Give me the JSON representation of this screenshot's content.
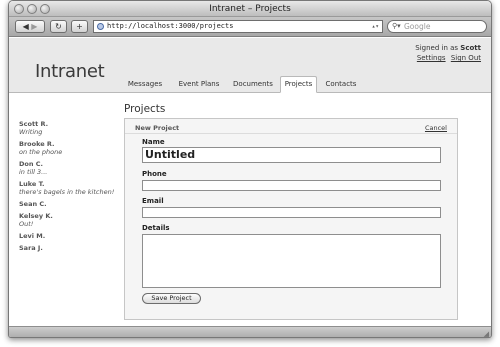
{
  "window": {
    "title": "Intranet – Projects"
  },
  "toolbar": {
    "back_icon": "◀",
    "forward_icon": "▶",
    "reload_icon": "↻",
    "add_icon": "+",
    "url": "http://localhost:3000/projects",
    "search_placeholder": "Google"
  },
  "header": {
    "logo": "Intranet",
    "signed_prefix": "Signed in as",
    "user": "Scott",
    "settings": "Settings",
    "sign_out": "Sign Out"
  },
  "tabs": [
    {
      "label": "Messages"
    },
    {
      "label": "Event Plans"
    },
    {
      "label": "Documents"
    },
    {
      "label": "Projects"
    },
    {
      "label": "Contacts"
    }
  ],
  "people": [
    {
      "name": "Scott R.",
      "status": "Writing"
    },
    {
      "name": "Brooke R.",
      "status": "on the phone"
    },
    {
      "name": "Don C.",
      "status": "in till 3..."
    },
    {
      "name": "Luke T.",
      "status": "there's bagels in the kitchen!"
    },
    {
      "name": "Sean C.",
      "status": ""
    },
    {
      "name": "Kelsey K.",
      "status": "Out!"
    },
    {
      "name": "Levi M.",
      "status": ""
    },
    {
      "name": "Sara J.",
      "status": ""
    }
  ],
  "main": {
    "title": "Projects",
    "panel_title": "New Project",
    "cancel": "Cancel",
    "fields": {
      "name_label": "Name",
      "name_value": "Untitled",
      "phone_label": "Phone",
      "phone_value": "",
      "email_label": "Email",
      "email_value": "",
      "details_label": "Details",
      "details_value": ""
    },
    "save_label": "Save Project"
  }
}
